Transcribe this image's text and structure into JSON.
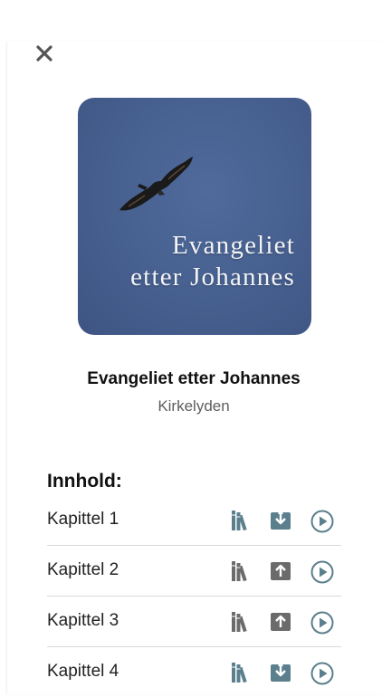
{
  "cover": {
    "title_line1": "Evangeliet",
    "title_line2": "etter Johannes",
    "background_color": "#465f8e"
  },
  "book": {
    "title": "Evangeliet etter Johannes",
    "author": "Kirkelyden"
  },
  "contents": {
    "heading": "Innhold:",
    "chapters": [
      {
        "label": "Kapittel 1",
        "download_state": "downloaded"
      },
      {
        "label": "Kapittel 2",
        "download_state": "not-downloaded"
      },
      {
        "label": "Kapittel 3",
        "download_state": "not-downloaded"
      },
      {
        "label": "Kapittel 4",
        "download_state": "downloaded"
      }
    ]
  },
  "colors": {
    "icon_teal": "#5b7f8c",
    "icon_gray": "#6b6b6b",
    "close_icon": "#555555"
  },
  "icons": {
    "close": "close-icon",
    "library": "library-books-icon",
    "downloaded": "download-icon",
    "not_downloaded": "upload-icon",
    "play": "play-circle-icon"
  }
}
